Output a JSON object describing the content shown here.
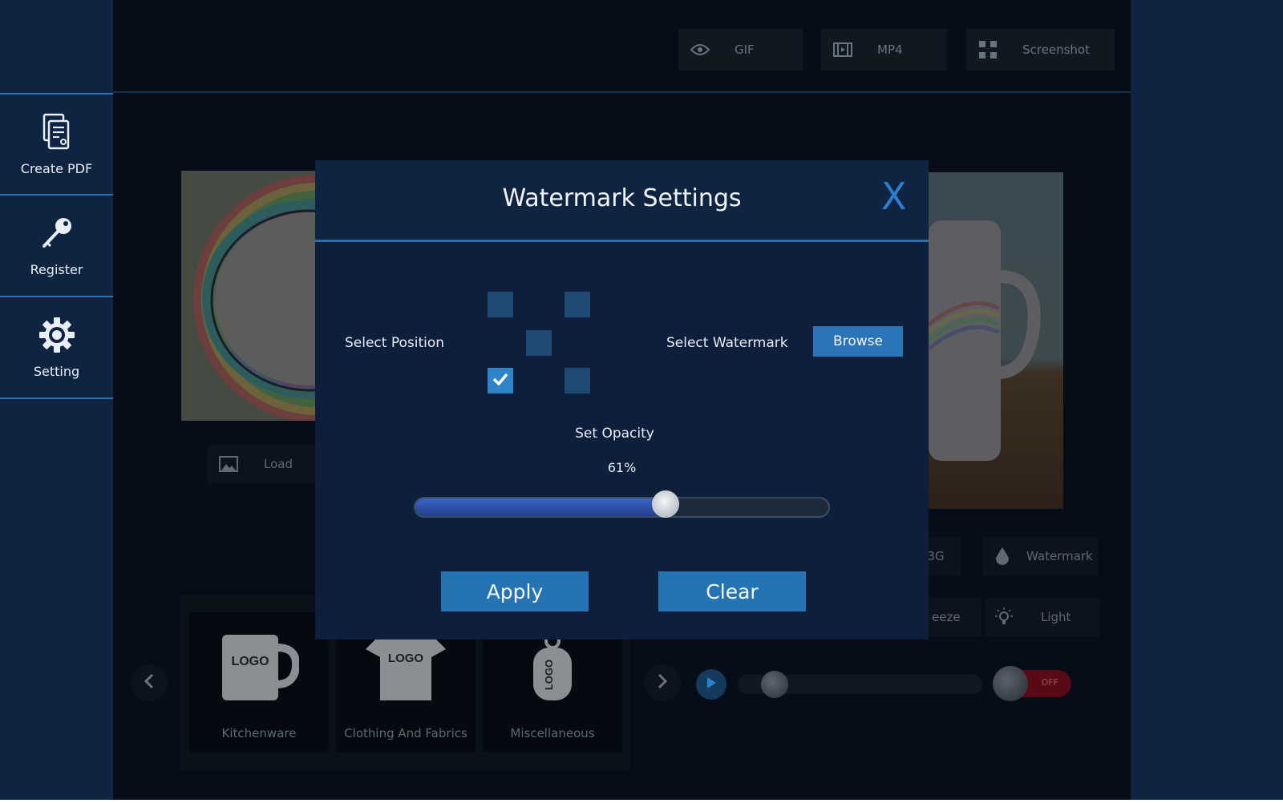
{
  "sidebar": {
    "items": [
      {
        "label": "Create PDF",
        "icon": "document-icon"
      },
      {
        "label": "Register",
        "icon": "key-icon"
      },
      {
        "label": "Setting",
        "icon": "gear-icon"
      }
    ]
  },
  "topbar": {
    "buttons": [
      {
        "label": "GIF",
        "icon": "eye-icon"
      },
      {
        "label": "MP4",
        "icon": "film-icon"
      },
      {
        "label": "Screenshot",
        "icon": "capture-frame-icon"
      }
    ]
  },
  "background": {
    "load_label": "Load",
    "bg_label": "BG",
    "watermark_label": "Watermark",
    "freeze_label": "eeze",
    "light_label": "Light",
    "categories": [
      "Kitchenware",
      "Clothing And Fabrics",
      "Miscellaneous"
    ],
    "logo_text": "LOGO",
    "toggle_label": "OFF",
    "video_progress": 0.15
  },
  "modal": {
    "title": "Watermark Settings",
    "close_label": "X",
    "select_position_label": "Select Position",
    "select_watermark_label": "Select Watermark",
    "browse_label": "Browse",
    "positions": {
      "top-left": false,
      "top-right": false,
      "center": false,
      "bottom-left": true,
      "bottom-right": false
    },
    "set_opacity_label": "Set Opacity",
    "opacity_value": 61,
    "opacity_text": "61%",
    "apply_label": "Apply",
    "clear_label": "Clear"
  },
  "colors": {
    "accent": "#2a74b7",
    "close_x": "#2b7fd0",
    "toggle_off": "#5a0a14"
  }
}
